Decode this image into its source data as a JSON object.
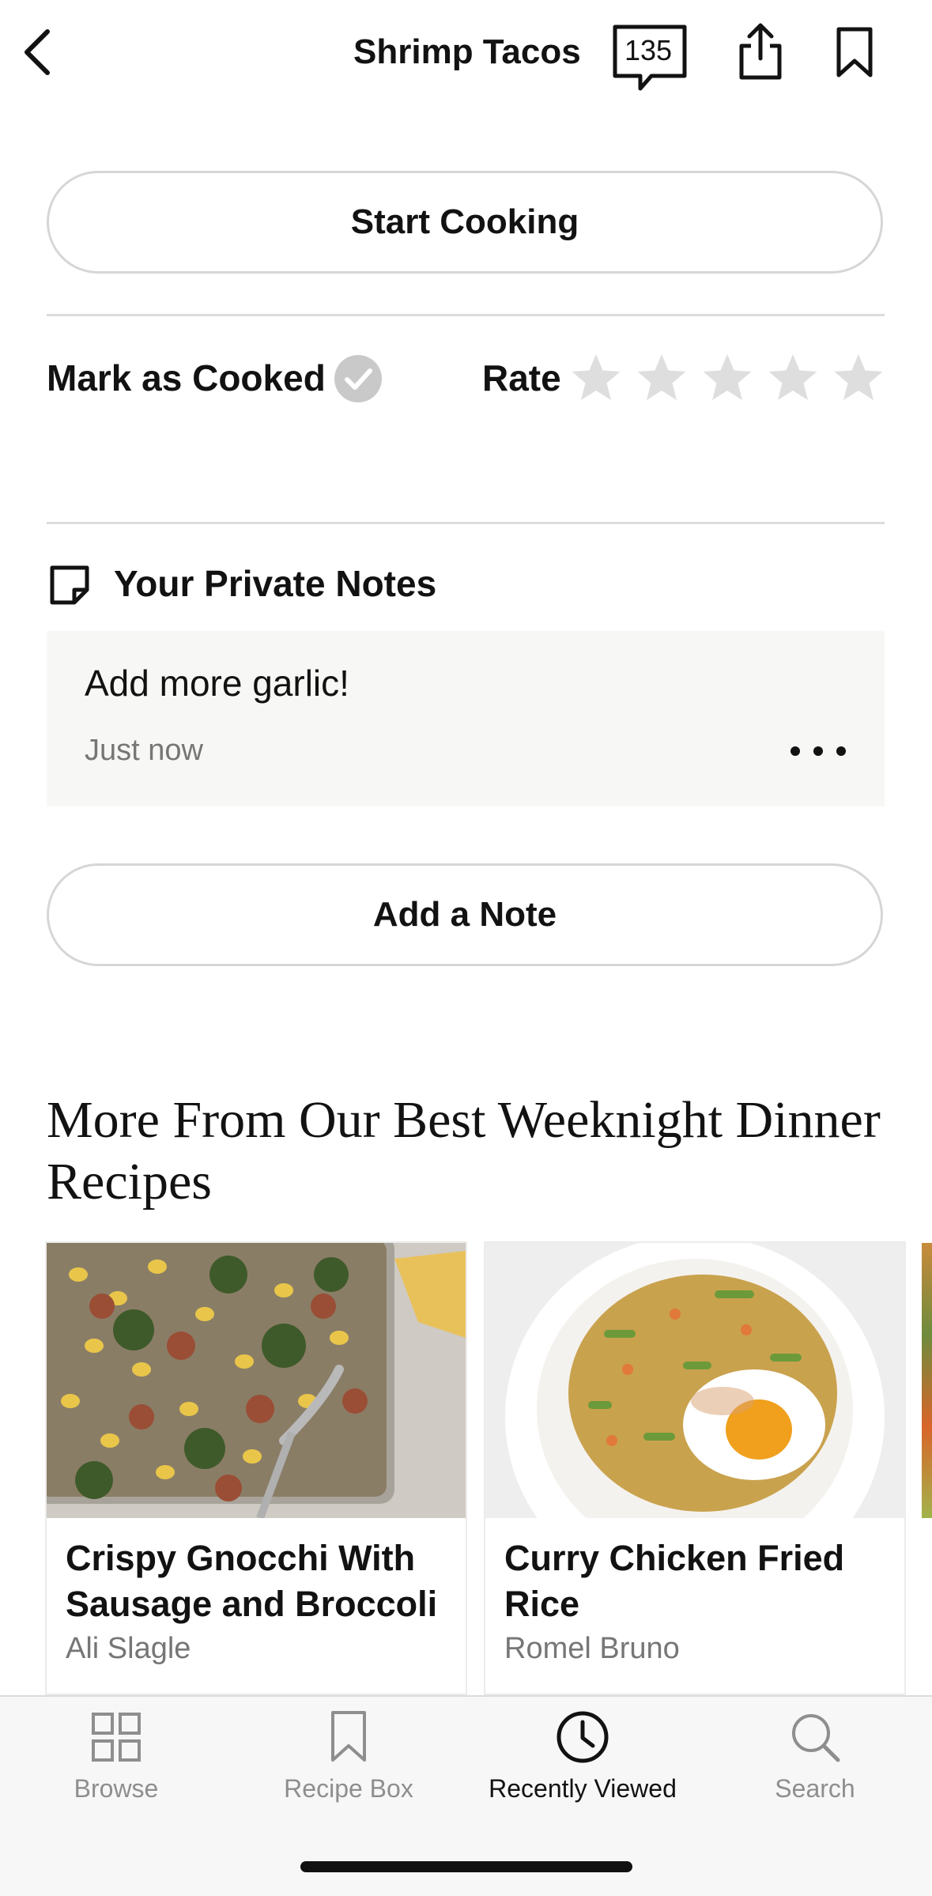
{
  "header": {
    "title": "Shrimp Tacos",
    "comment_count": "135",
    "back_icon": "chevron-left-icon",
    "share_icon": "share-icon",
    "bookmark_icon": "bookmark-icon"
  },
  "actions": {
    "start_cooking": "Start Cooking",
    "mark_as_cooked": "Mark as Cooked",
    "rate_label": "Rate",
    "rating": {
      "value": 0,
      "max": 5
    }
  },
  "notes": {
    "title": "Your Private Notes",
    "items": [
      {
        "text": "Add more garlic!",
        "time": "Just now"
      }
    ],
    "add_note": "Add a Note"
  },
  "more": {
    "title": "More From Our Best Weeknight Dinner Recipes",
    "cards": [
      {
        "title": "Crispy Gnocchi With Sausage and Broccoli",
        "author": "Ali Slagle"
      },
      {
        "title": "Curry Chicken Fried Rice",
        "author": "Romel Bruno"
      }
    ]
  },
  "tabbar": {
    "items": [
      {
        "label": "Browse",
        "icon": "grid-icon",
        "active": false
      },
      {
        "label": "Recipe Box",
        "icon": "bookmark-icon",
        "active": false
      },
      {
        "label": "Recently Viewed",
        "icon": "clock-icon",
        "active": true
      },
      {
        "label": "Search",
        "icon": "search-icon",
        "active": false
      }
    ]
  },
  "colors": {
    "text": "#121212",
    "muted": "#767676",
    "border": "#d6d6d6",
    "note_bg": "#f7f7f5",
    "tabbar_bg": "#f7f7f7",
    "inactive": "#8e8e8e"
  }
}
